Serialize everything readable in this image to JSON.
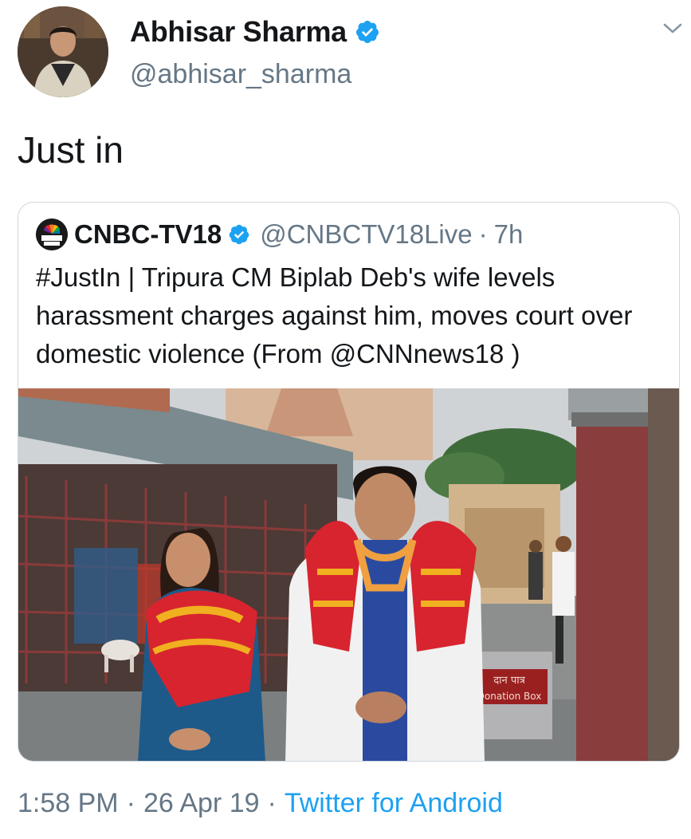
{
  "tweet": {
    "author": {
      "display_name": "Abhisar Sharma",
      "handle": "@abhisar_sharma",
      "verified": true
    },
    "text": "Just in",
    "time": "1:58 PM",
    "separator": "·",
    "date": "26 Apr 19",
    "source": "Twitter for Android"
  },
  "quoted_tweet": {
    "author": {
      "display_name": "CNBC-TV18",
      "handle": "@CNBCTV18Live",
      "verified": true,
      "logo_label": "CNBC TV18"
    },
    "separator": "·",
    "age": "7h",
    "text": "#JustIn | Tripura CM Biplab Deb's wife levels harassment charges against him, moves court over domestic violence (From @CNNnews18 )",
    "photo": {
      "sign_text_1": "दान पात्र",
      "sign_text_2": "Donation Box"
    }
  },
  "icons": {
    "verified": "verified-badge-icon",
    "menu": "chevron-down-icon"
  },
  "colors": {
    "primary_text": "#14171a",
    "secondary_text": "#657786",
    "link": "#1da1f2",
    "verified": "#1da1f2",
    "border": "#d0d8de"
  }
}
